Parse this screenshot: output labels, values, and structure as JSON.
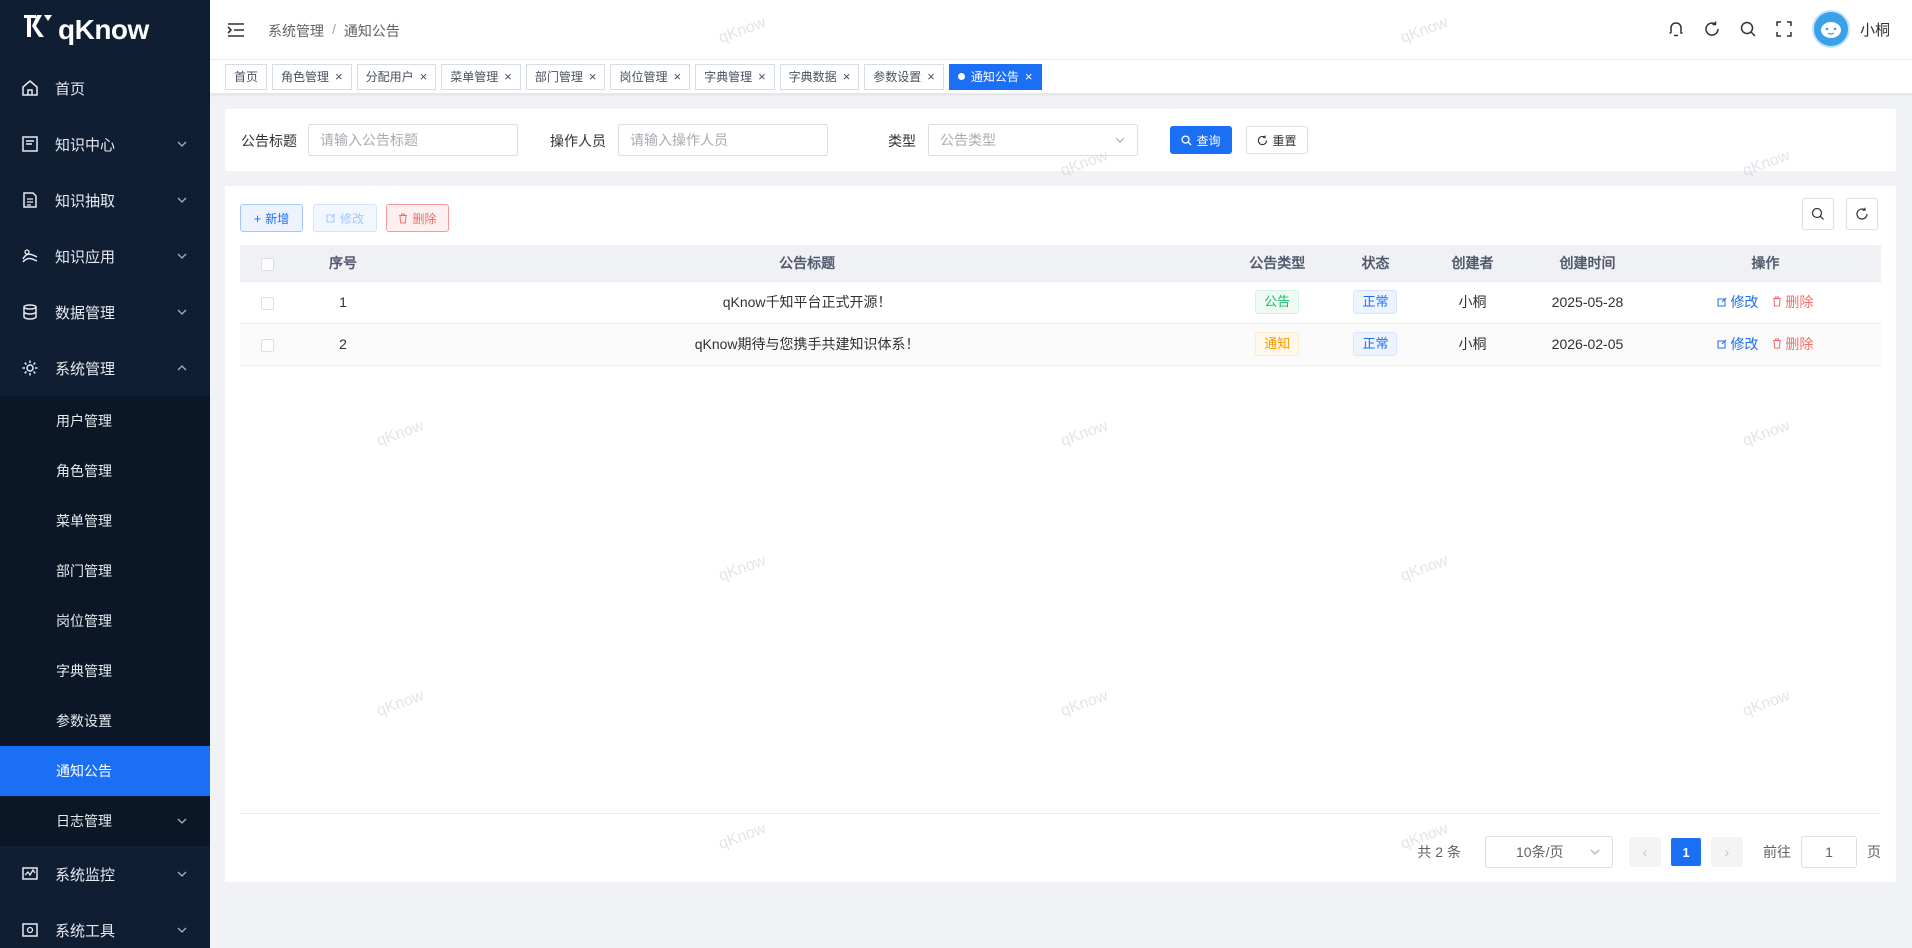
{
  "brand": {
    "name": "qKnow"
  },
  "sidebar": {
    "top_items": [
      {
        "label": "首页",
        "icon": "home-icon",
        "has_children": false
      },
      {
        "label": "知识中心",
        "icon": "book-icon",
        "has_children": true
      },
      {
        "label": "知识抽取",
        "icon": "extract-icon",
        "has_children": true
      },
      {
        "label": "知识应用",
        "icon": "app-icon",
        "has_children": true
      },
      {
        "label": "数据管理",
        "icon": "database-icon",
        "has_children": true
      },
      {
        "label": "系统管理",
        "icon": "gear-icon",
        "has_children": true,
        "expanded": true
      }
    ],
    "sub_items": [
      {
        "label": "用户管理"
      },
      {
        "label": "角色管理"
      },
      {
        "label": "菜单管理"
      },
      {
        "label": "部门管理"
      },
      {
        "label": "岗位管理"
      },
      {
        "label": "字典管理"
      },
      {
        "label": "参数设置"
      },
      {
        "label": "通知公告",
        "active": true
      },
      {
        "label": "日志管理",
        "has_children": true
      }
    ],
    "bottom_items": [
      {
        "label": "系统监控",
        "icon": "monitor-icon",
        "has_children": true
      },
      {
        "label": "系统工具",
        "icon": "tool-icon",
        "has_children": true
      }
    ]
  },
  "header": {
    "breadcrumb": [
      "系统管理",
      "通知公告"
    ],
    "username": "小桐"
  },
  "tags": [
    {
      "label": "首页",
      "closable": false
    },
    {
      "label": "角色管理",
      "closable": true
    },
    {
      "label": "分配用户",
      "closable": true
    },
    {
      "label": "菜单管理",
      "closable": true
    },
    {
      "label": "部门管理",
      "closable": true
    },
    {
      "label": "岗位管理",
      "closable": true
    },
    {
      "label": "字典管理",
      "closable": true
    },
    {
      "label": "字典数据",
      "closable": true
    },
    {
      "label": "参数设置",
      "closable": true
    },
    {
      "label": "通知公告",
      "closable": true,
      "active": true
    }
  ],
  "search": {
    "title_label": "公告标题",
    "title_placeholder": "请输入公告标题",
    "operator_label": "操作人员",
    "operator_placeholder": "请输入操作人员",
    "type_label": "类型",
    "type_placeholder": "公告类型",
    "query_button": "查询",
    "reset_button": "重置"
  },
  "toolbar": {
    "add": "新增",
    "edit": "修改",
    "delete": "删除"
  },
  "table": {
    "columns": [
      "序号",
      "公告标题",
      "公告类型",
      "状态",
      "创建者",
      "创建时间",
      "操作"
    ],
    "rows": [
      {
        "index": "1",
        "title": "qKnow千知平台正式开源！",
        "type": "公告",
        "type_color": "green",
        "status": "正常",
        "creator": "小桐",
        "created": "2025-05-28",
        "edit": "修改",
        "delete": "删除"
      },
      {
        "index": "2",
        "title": "qKnow期待与您携手共建知识体系！",
        "type": "通知",
        "type_color": "orange",
        "status": "正常",
        "creator": "小桐",
        "created": "2026-02-05",
        "edit": "修改",
        "delete": "删除"
      }
    ]
  },
  "pagination": {
    "total": "共 2 条",
    "page_size": "10条/页",
    "current": "1",
    "goto_prefix": "前往",
    "goto_value": "1",
    "goto_suffix": "页"
  },
  "watermark": "qKnow",
  "colors": {
    "primary": "#1b6ff5",
    "sidebar": "#0f1e33",
    "danger": "#f56c6c",
    "success": "#19be6b",
    "warning": "#ff9900"
  }
}
